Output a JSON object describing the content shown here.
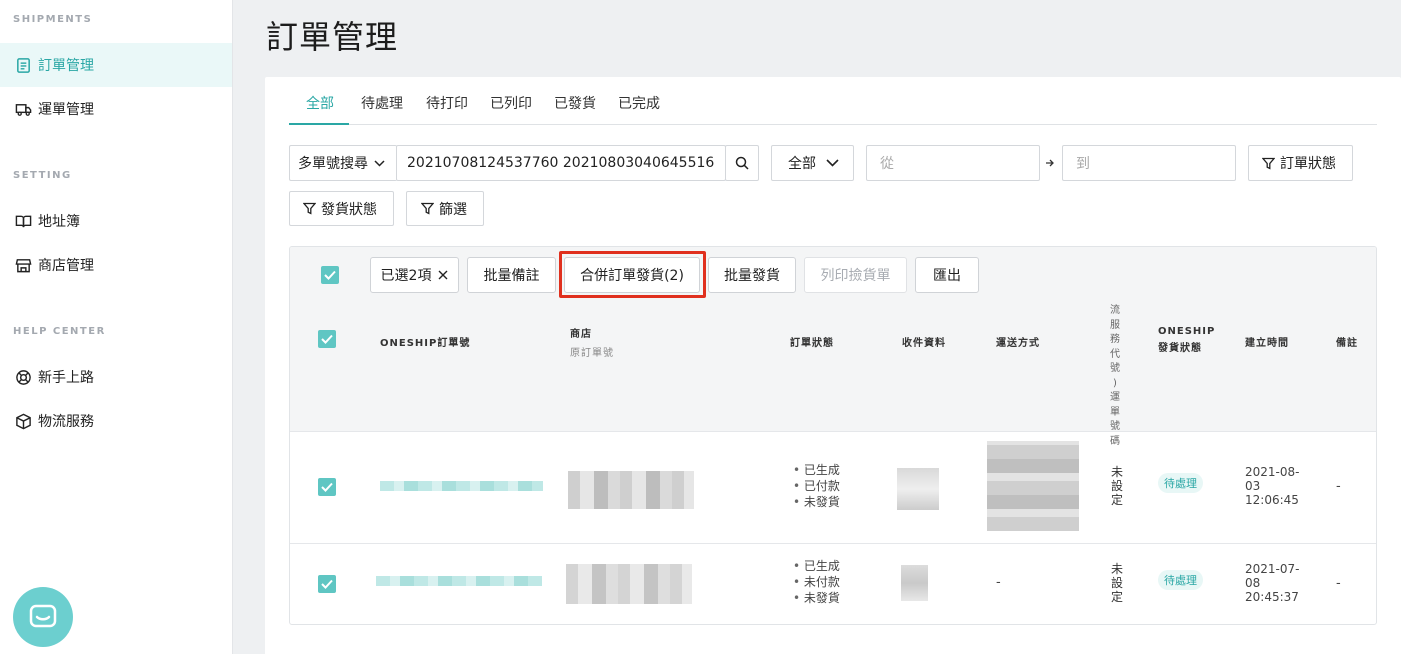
{
  "sidebar": {
    "sections": [
      {
        "title": "SHIPMENTS",
        "items": [
          {
            "label": "訂單管理",
            "icon": "order-list-icon",
            "active": true
          },
          {
            "label": "運單管理",
            "icon": "truck-icon"
          }
        ]
      },
      {
        "title": "SETTING",
        "items": [
          {
            "label": "地址簿",
            "icon": "book-icon"
          },
          {
            "label": "商店管理",
            "icon": "store-icon"
          }
        ]
      },
      {
        "title": "HELP CENTER",
        "items": [
          {
            "label": "新手上路",
            "icon": "lifebuoy-icon"
          },
          {
            "label": "物流服務",
            "icon": "box-icon"
          }
        ]
      }
    ]
  },
  "page": {
    "title": "訂單管理"
  },
  "tabs": [
    "全部",
    "待處理",
    "待打印",
    "已列印",
    "已發貨",
    "已完成"
  ],
  "filters": {
    "search_type": "多單號搜尋",
    "search_value": "20210708124537760 20210803040645516",
    "scope": "全部",
    "from_placeholder": "從",
    "to_placeholder": "到",
    "order_status": "訂單狀態",
    "shipping_status": "發貨狀態",
    "filter": "篩選"
  },
  "bulk": {
    "selected": "已選2項",
    "bulk_note": "批量備註",
    "merge_ship": "合併訂單發貨(2)",
    "bulk_ship": "批量發貨",
    "print_pick": "列印撿貨單",
    "export": "匯出"
  },
  "columns": {
    "oneship_no": "ONESHIP訂單號",
    "store": "商店",
    "store_sub": "原訂單號",
    "order_status": "訂單狀態",
    "recipient": "收件資料",
    "delivery": "運送方式",
    "tracking": "流服務代號)運單號碼",
    "ship_status": "ONESHIP",
    "ship_status_sub": "發貨狀態",
    "created": "建立時間",
    "note": "備註"
  },
  "rows": [
    {
      "statuses": [
        "已生成",
        "已付款",
        "未發貨"
      ],
      "tracking": "未設定",
      "badge": "待處理",
      "date": [
        "2021-08-",
        "03",
        "12:06:45"
      ],
      "note": "-",
      "delivery": ""
    },
    {
      "statuses": [
        "已生成",
        "未付款",
        "未發貨"
      ],
      "tracking": "未設定",
      "badge": "待處理",
      "date": [
        "2021-07-",
        "08",
        "20:45:37"
      ],
      "note": "-",
      "delivery": "-"
    }
  ],
  "colors": {
    "accent": "#2aa7a5",
    "highlight": "#e0301e"
  }
}
